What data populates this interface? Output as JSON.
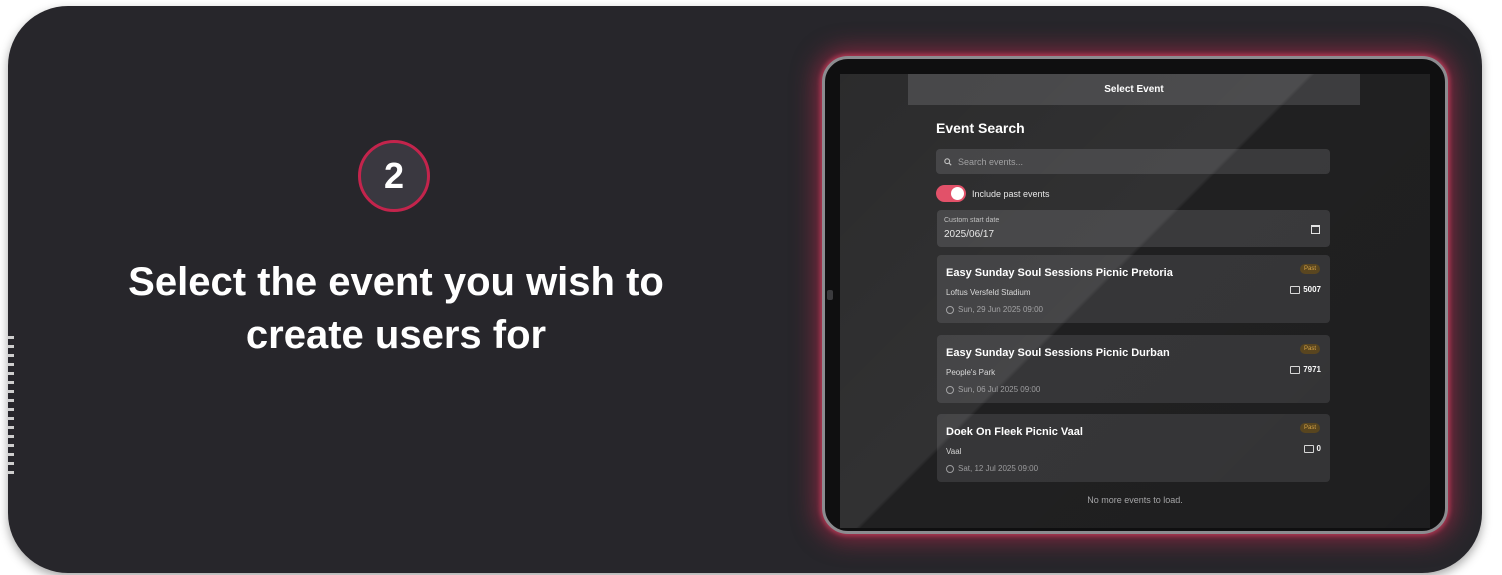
{
  "step": {
    "number": "2"
  },
  "headline": "Select the event you wish to\ncreate users for",
  "screen": {
    "topbar_title": "Select Event",
    "search_title": "Event Search",
    "search_placeholder": "Search events...",
    "toggle": {
      "label": "Include past events",
      "on": true
    },
    "date_field": {
      "label": "Custom start date",
      "value": "2025/06/17"
    },
    "events": [
      {
        "title": "Easy Sunday Soul Sessions Picnic Pretoria",
        "venue": "Loftus Versfeld Stadium",
        "date": "Sun, 29 Jun 2025 09:00",
        "badge": "Past",
        "tickets": "5007"
      },
      {
        "title": "Easy Sunday Soul Sessions Picnic Durban",
        "venue": "People's Park",
        "date": "Sun, 06 Jul 2025 09:00",
        "badge": "Past",
        "tickets": "7971"
      },
      {
        "title": "Doek On Fleek Picnic Vaal",
        "venue": "Vaal",
        "date": "Sat, 12 Jul 2025 09:00",
        "badge": "Past",
        "tickets": "0"
      }
    ],
    "footer": "No more events to load."
  },
  "colors": {
    "card_bg": "#27262b",
    "accent": "#e0455f",
    "badge_ring": "#c3244c",
    "past_badge": "#d9a648"
  },
  "icons": [
    "search-icon",
    "calendar-icon",
    "clock-icon",
    "ticket-icon"
  ]
}
